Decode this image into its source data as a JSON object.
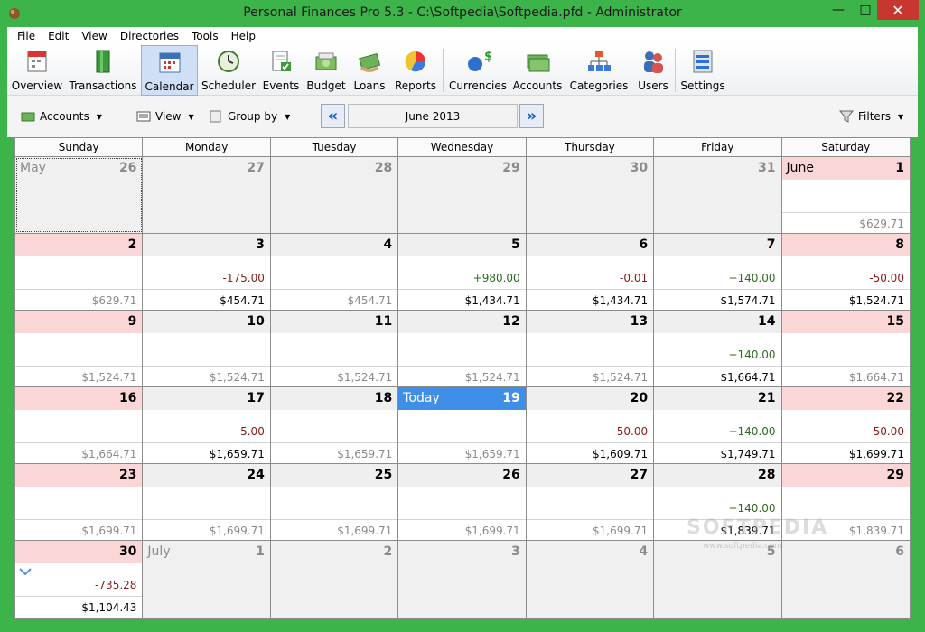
{
  "window": {
    "title": "Personal Finances Pro 5.3 - C:\\Softpedia\\Softpedia.pfd - Administrator",
    "minimize": "—",
    "maximize": "□",
    "close": "✕"
  },
  "menu": [
    "File",
    "Edit",
    "View",
    "Directories",
    "Tools",
    "Help"
  ],
  "toolbar": [
    {
      "label": "Overview",
      "icon": "overview-icon"
    },
    {
      "label": "Transactions",
      "icon": "transactions-icon"
    },
    {
      "label": "Calendar",
      "icon": "calendar-icon",
      "active": true
    },
    {
      "label": "Scheduler",
      "icon": "scheduler-icon"
    },
    {
      "label": "Events",
      "icon": "events-icon"
    },
    {
      "label": "Budget",
      "icon": "budget-icon"
    },
    {
      "label": "Loans",
      "icon": "loans-icon"
    },
    {
      "label": "Reports",
      "icon": "reports-icon"
    },
    {
      "label": "Currencies",
      "icon": "currencies-icon"
    },
    {
      "label": "Accounts",
      "icon": "accounts-icon"
    },
    {
      "label": "Categories",
      "icon": "categories-icon"
    },
    {
      "label": "Users",
      "icon": "users-icon"
    },
    {
      "label": "Settings",
      "icon": "settings-icon"
    }
  ],
  "filterbar": {
    "accounts": "Accounts",
    "view": "View",
    "group_by": "Group by",
    "month": "June 2013",
    "filters": "Filters"
  },
  "calendar": {
    "weekdays": [
      "Sunday",
      "Monday",
      "Tuesday",
      "Wednesday",
      "Thursday",
      "Friday",
      "Saturday"
    ],
    "weeks": [
      [
        {
          "day": "26",
          "month_label": "May",
          "other": true,
          "selected": true
        },
        {
          "day": "27",
          "other": true
        },
        {
          "day": "28",
          "other": true
        },
        {
          "day": "29",
          "other": true
        },
        {
          "day": "30",
          "other": true
        },
        {
          "day": "31",
          "other": true
        },
        {
          "day": "1",
          "month_label": "June",
          "weekend": true,
          "balance": "$629.71",
          "balance_dim": true
        }
      ],
      [
        {
          "day": "2",
          "weekend": true,
          "balance": "$629.71",
          "balance_dim": true
        },
        {
          "day": "3",
          "change": "-175.00",
          "balance": "$454.71"
        },
        {
          "day": "4",
          "balance": "$454.71",
          "balance_dim": true
        },
        {
          "day": "5",
          "change": "+980.00",
          "balance": "$1,434.71"
        },
        {
          "day": "6",
          "change": "-0.01",
          "balance": "$1,434.71"
        },
        {
          "day": "7",
          "change": "+140.00",
          "balance": "$1,574.71"
        },
        {
          "day": "8",
          "weekend": true,
          "change": "-50.00",
          "balance": "$1,524.71"
        }
      ],
      [
        {
          "day": "9",
          "weekend": true,
          "balance": "$1,524.71",
          "balance_dim": true
        },
        {
          "day": "10",
          "balance": "$1,524.71",
          "balance_dim": true
        },
        {
          "day": "11",
          "balance": "$1,524.71",
          "balance_dim": true
        },
        {
          "day": "12",
          "balance": "$1,524.71",
          "balance_dim": true
        },
        {
          "day": "13",
          "balance": "$1,524.71",
          "balance_dim": true
        },
        {
          "day": "14",
          "change": "+140.00",
          "balance": "$1,664.71"
        },
        {
          "day": "15",
          "weekend": true,
          "balance": "$1,664.71",
          "balance_dim": true
        }
      ],
      [
        {
          "day": "16",
          "weekend": true,
          "balance": "$1,664.71",
          "balance_dim": true
        },
        {
          "day": "17",
          "change": "-5.00",
          "balance": "$1,659.71"
        },
        {
          "day": "18",
          "balance": "$1,659.71",
          "balance_dim": true
        },
        {
          "day": "19",
          "month_label": "Today",
          "today": true,
          "balance": "$1,659.71",
          "balance_dim": true
        },
        {
          "day": "20",
          "change": "-50.00",
          "balance": "$1,609.71"
        },
        {
          "day": "21",
          "change": "+140.00",
          "balance": "$1,749.71"
        },
        {
          "day": "22",
          "weekend": true,
          "change": "-50.00",
          "balance": "$1,699.71"
        }
      ],
      [
        {
          "day": "23",
          "weekend": true,
          "balance": "$1,699.71",
          "balance_dim": true
        },
        {
          "day": "24",
          "balance": "$1,699.71",
          "balance_dim": true
        },
        {
          "day": "25",
          "balance": "$1,699.71",
          "balance_dim": true
        },
        {
          "day": "26",
          "balance": "$1,699.71",
          "balance_dim": true
        },
        {
          "day": "27",
          "balance": "$1,699.71",
          "balance_dim": true
        },
        {
          "day": "28",
          "change": "+140.00",
          "balance": "$1,839.71"
        },
        {
          "day": "29",
          "weekend": true,
          "balance": "$1,839.71",
          "balance_dim": true
        }
      ],
      [
        {
          "day": "30",
          "weekend": true,
          "change": "-735.28",
          "balance": "$1,104.43",
          "expand": true
        },
        {
          "day": "1",
          "month_label": "July",
          "other": true
        },
        {
          "day": "2",
          "other": true
        },
        {
          "day": "3",
          "other": true
        },
        {
          "day": "4",
          "other": true
        },
        {
          "day": "5",
          "other": true
        },
        {
          "day": "6",
          "other": true
        }
      ]
    ]
  },
  "watermark": {
    "text": "SOFTPEDIA",
    "sub": "www.softpedia.com"
  }
}
